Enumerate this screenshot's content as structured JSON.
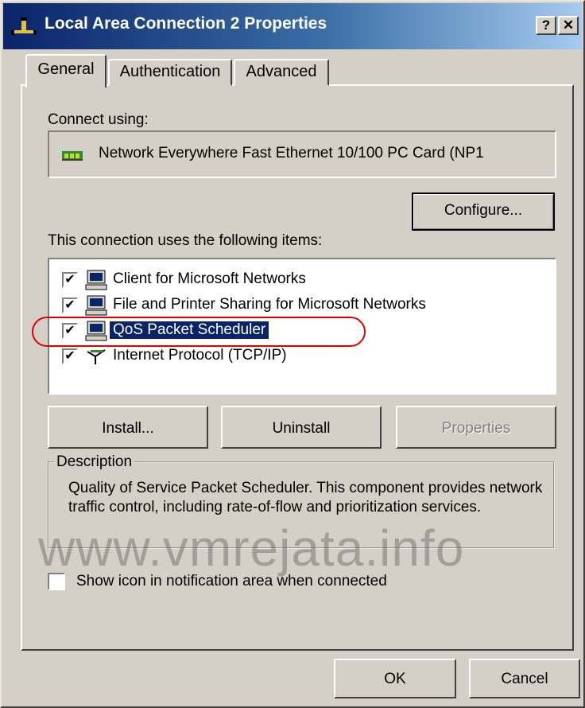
{
  "window": {
    "title": "Local Area Connection 2 Properties",
    "help_button": "?",
    "close_button": "✕"
  },
  "tabs": [
    {
      "label": "General"
    },
    {
      "label": "Authentication"
    },
    {
      "label": "Advanced"
    }
  ],
  "general": {
    "connect_using_label": "Connect using:",
    "adapter_name": "Network Everywhere Fast Ethernet 10/100 PC Card (NP1",
    "configure_button": "Configure...",
    "items_label": "This connection uses the following items:",
    "items": [
      {
        "label": "Client for Microsoft Networks",
        "checked": true
      },
      {
        "label": "File and Printer Sharing for Microsoft Networks",
        "checked": true
      },
      {
        "label": "QoS Packet Scheduler",
        "checked": true,
        "selected": true
      },
      {
        "label": "Internet Protocol (TCP/IP)",
        "checked": true
      }
    ],
    "install_button": "Install...",
    "uninstall_button": "Uninstall",
    "properties_button": "Properties",
    "description_title": "Description",
    "description_text": "Quality of Service Packet Scheduler. This component provides network traffic control, including rate-of-flow and prioritization services.",
    "show_icon_label": "Show icon in notification area when connected",
    "show_icon_checked": false
  },
  "footer": {
    "ok_button": "OK",
    "cancel_button": "Cancel"
  },
  "watermark": "www.vmrejata.info",
  "colors": {
    "title_gradient_start": "#0a246a",
    "title_gradient_end": "#a6caf0",
    "dialog_face": "#d4d0c8",
    "selection": "#0a246a",
    "annotation_ring": "#e00000"
  }
}
